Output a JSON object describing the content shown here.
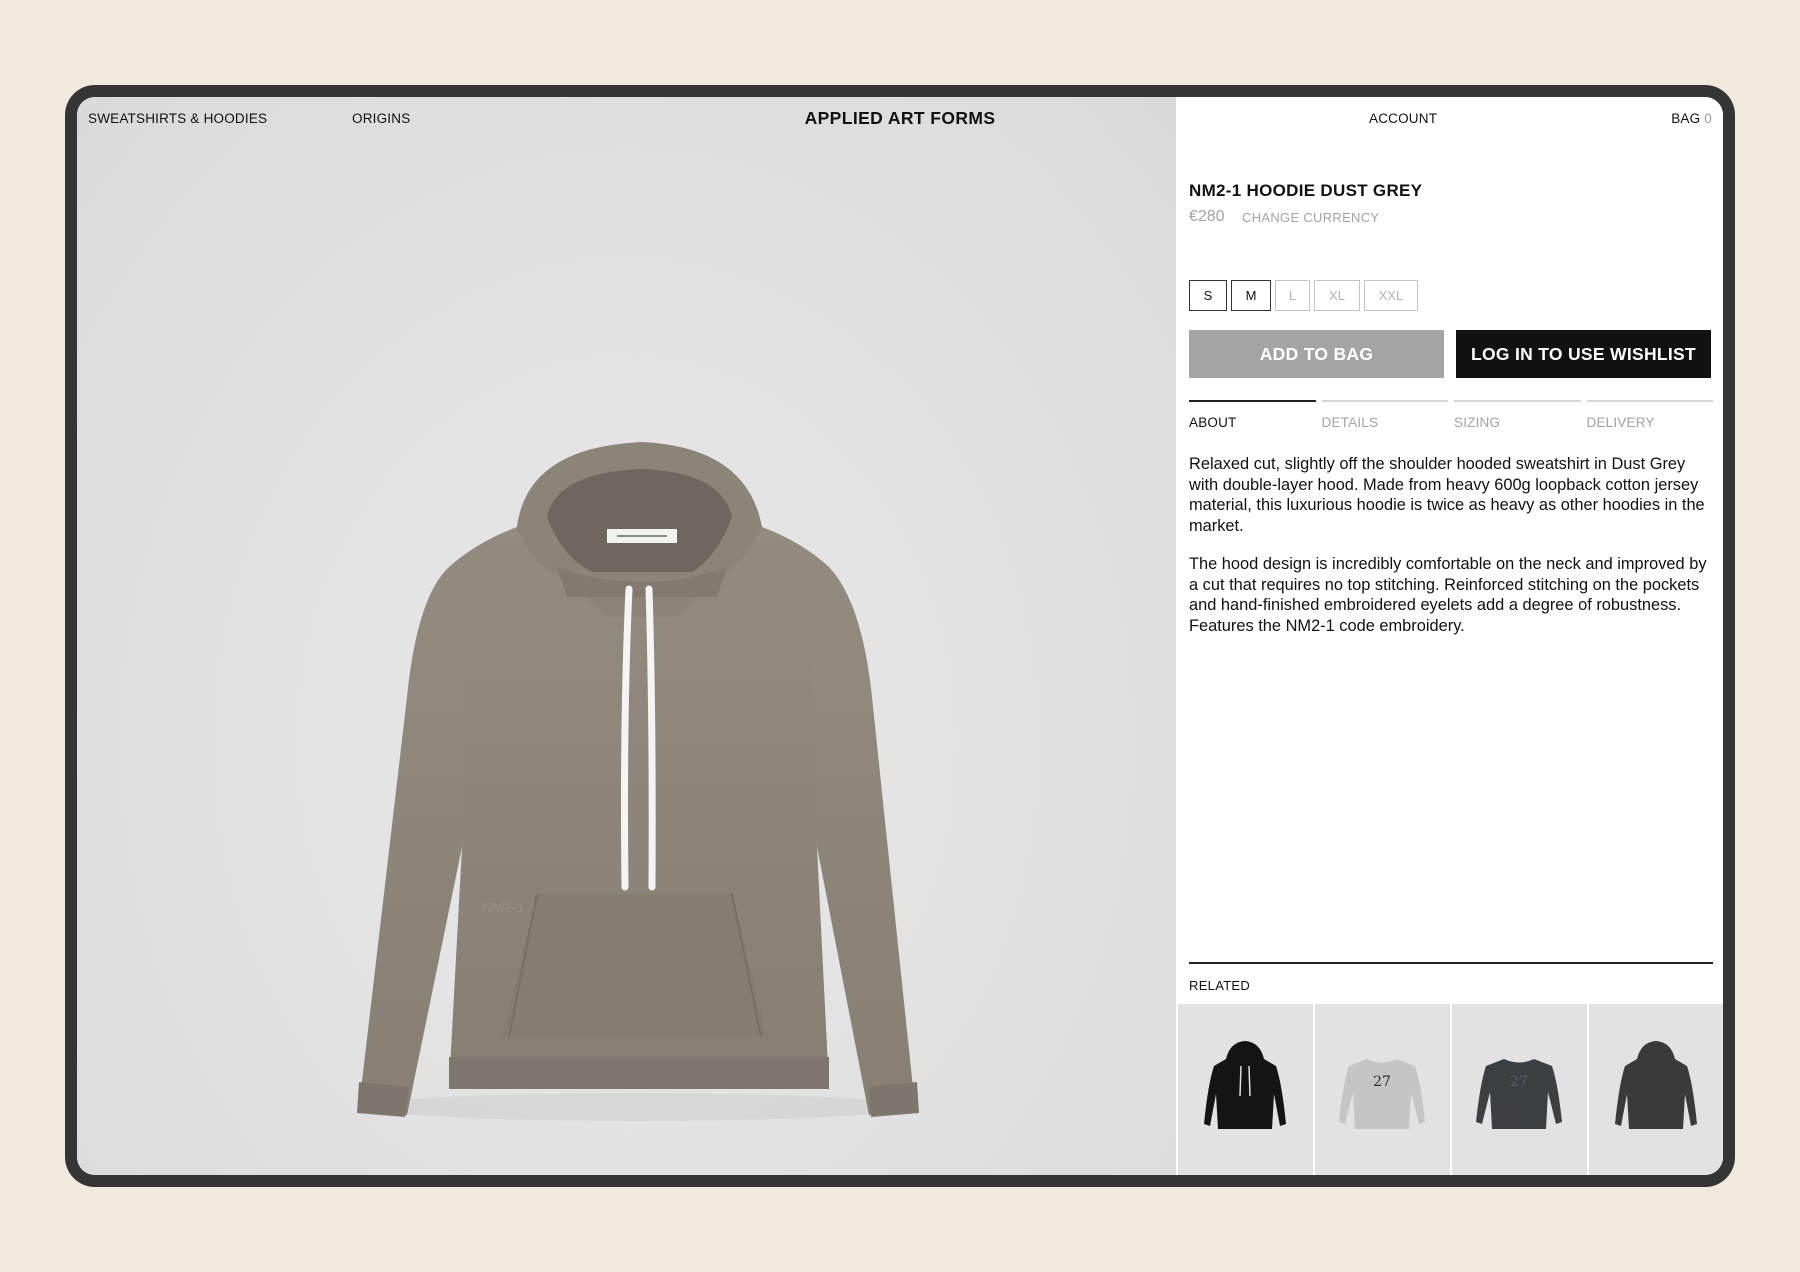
{
  "nav": {
    "category": "SWEATSHIRTS & HOODIES",
    "origins": "ORIGINS",
    "brand": "APPLIED ART FORMS",
    "account": "ACCOUNT",
    "bag_label": "BAG",
    "bag_count": "0"
  },
  "product": {
    "title": "NM2-1 HOODIE DUST GREY",
    "price": "€280",
    "change_currency": "CHANGE CURRENCY",
    "sizes": [
      {
        "label": "S",
        "available": true
      },
      {
        "label": "M",
        "available": true
      },
      {
        "label": "L",
        "available": false
      },
      {
        "label": "XL",
        "available": false
      },
      {
        "label": "XXL",
        "available": false
      }
    ],
    "add_to_bag": "ADD TO BAG",
    "wishlist": "LOG IN TO USE WISHLIST",
    "hoodie_color": "#8f867b"
  },
  "tabs": [
    {
      "label": "ABOUT",
      "active": true
    },
    {
      "label": "DETAILS",
      "active": false
    },
    {
      "label": "SIZING",
      "active": false
    },
    {
      "label": "DELIVERY",
      "active": false
    }
  ],
  "about": {
    "p1": "Relaxed cut, slightly off the shoulder hooded sweatshirt in Dust Grey with double-layer hood. Made from heavy 600g loopback cotton jersey material, this luxurious hoodie is twice as heavy as other hoodies in the market.",
    "p2": "The hood design is incredibly comfortable on the neck and improved by a cut that requires no top stitching. Reinforced stitching on the pockets and hand-finished embroidered eyelets add a degree of robustness. Features the NM2-1 code embroidery."
  },
  "related": {
    "label": "RELATED",
    "items": [
      {
        "icon": "black-hoodie-image",
        "color": "#141414",
        "print": ""
      },
      {
        "icon": "grey-sweatshirt-27-image",
        "color": "#c5c5c5",
        "print": "27"
      },
      {
        "icon": "charcoal-sweatshirt-27-image",
        "color": "#3d4043",
        "print": "27"
      },
      {
        "icon": "charcoal-hoodie-image",
        "color": "#3a3a3a",
        "print": ""
      }
    ]
  }
}
